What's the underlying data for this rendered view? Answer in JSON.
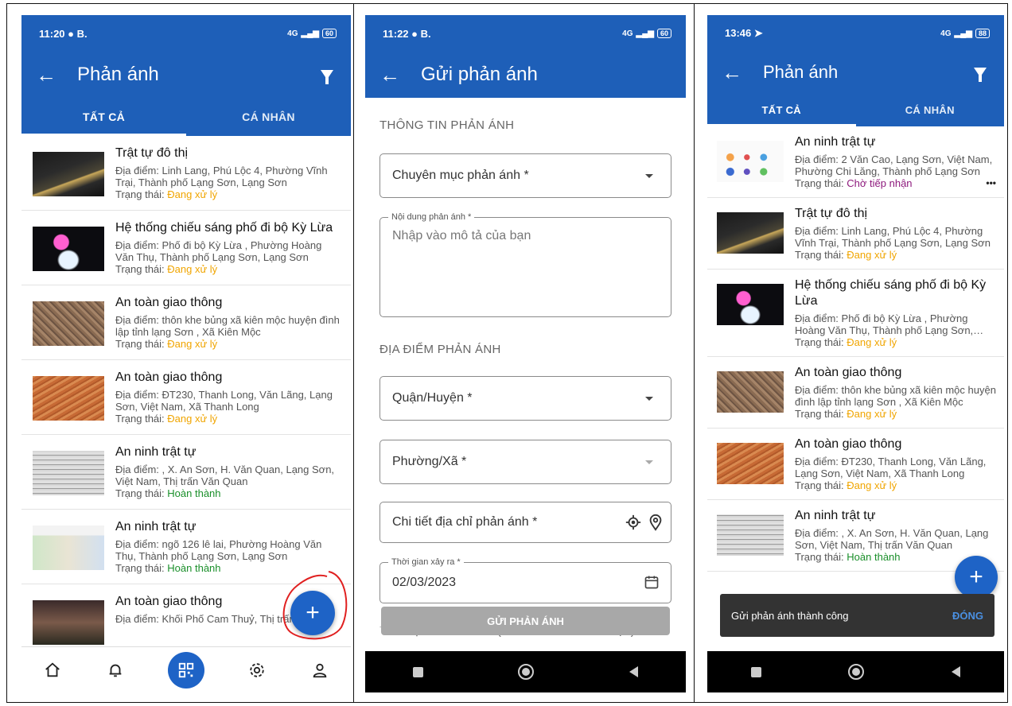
{
  "colors": {
    "primary": "#1e5fb8",
    "tab_bg": "#1e5fb8",
    "status_processing": "#f0a500",
    "status_done": "#1a8f2a",
    "status_waiting": "#8e1a7d"
  },
  "phone1": {
    "status": {
      "time": "11:20",
      "carrier": "B.",
      "network": "4G",
      "battery": "60"
    },
    "header": {
      "title": "Phản ánh"
    },
    "tabs": [
      "TẤT CẢ",
      "CÁ NHÂN"
    ],
    "items": [
      {
        "title": "Trật tự đô thị",
        "location": "Địa điểm: Linh Lang, Phú Lộc 4, Phường Vĩnh Trại, Thành phố Lạng Sơn, Lạng Sơn",
        "status_label": "Trạng thái: ",
        "status": "Đang xử lý"
      },
      {
        "title": "Hệ thống chiếu sáng phố đi bộ Kỳ Lừa",
        "location": "Địa điểm: Phố đi bộ Kỳ Lừa , Phường Hoàng Văn Thụ, Thành phố Lạng Sơn, Lạng Sơn",
        "status_label": "Trạng thái: ",
        "status": "Đang xử lý"
      },
      {
        "title": "An toàn giao thông",
        "location": "Địa điểm: thôn khe bủng xã kiên mộc huyện đình lập tỉnh lạng Sơn , Xã Kiên Mộc",
        "status_label": "Trạng thái: ",
        "status": "Đang xử lý"
      },
      {
        "title": "An toàn giao thông",
        "location": "Địa điểm: ĐT230, Thanh Long, Văn Lãng, Lạng Sơn, Việt Nam, Xã Thanh Long",
        "status_label": "Trạng thái: ",
        "status": "Đang xử lý"
      },
      {
        "title": "An ninh trật tự",
        "location": "Địa điểm: , X. An Sơn, H. Văn Quan, Lạng Sơn, Việt Nam, Thị trấn Văn Quan",
        "status_label": "Trạng thái: ",
        "status": "Hoàn thành"
      },
      {
        "title": "An ninh trật tự",
        "location": "Địa điểm: ngõ 126 lê lai, Phường Hoàng Văn Thụ, Thành phố Lạng Sơn, Lạng Sơn",
        "status_label": "Trạng thái: ",
        "status": "Hoàn thành"
      },
      {
        "title": "An toàn giao thông",
        "location": "Địa điểm: Khối Phố Cam Thuỷ, Thị trấn",
        "status_label": "",
        "status": ""
      }
    ],
    "fab": "+"
  },
  "phone2": {
    "status": {
      "time": "11:22",
      "carrier": "B.",
      "network": "4G",
      "battery": "60"
    },
    "header": {
      "title": "Gửi phản ánh"
    },
    "section_info": "THÔNG TIN PHẢN ÁNH",
    "category_field": "Chuyên mục phản ánh *",
    "content_label": "Nội dung phản ánh *",
    "content_placeholder": "Nhập vào mô tả của bạn",
    "section_location": "ĐỊA ĐIỂM PHẢN ÁNH",
    "district_field": "Quận/Huyện *",
    "ward_field": "Phường/Xã *",
    "address_field": "Chi tiết địa chỉ phản ánh *",
    "time_label": "Thời gian xảy ra *",
    "time_value": "02/03/2023",
    "section_attach": "TÀI LIỆU ĐÍNH KÈM (Hình ảnh/Video/Tài liệu) *",
    "submit": "GỬI PHẢN ÁNH"
  },
  "phone3": {
    "status": {
      "time": "13:46",
      "network": "4G",
      "battery": "88"
    },
    "header": {
      "title": "Phản ánh"
    },
    "tabs": [
      "TẤT CẢ",
      "CÁ NHÂN"
    ],
    "items": [
      {
        "title": "An ninh trật tự",
        "location": "Địa điểm: 2 Văn Cao, Lạng Sơn, Việt Nam, Phường Chi Lăng, Thành phố Lạng Sơn",
        "status_label": "Trạng thái: ",
        "status": "Chờ tiếp nhận"
      },
      {
        "title": "Trật tự đô thị",
        "location": "Địa điểm: Linh Lang, Phú Lộc 4, Phường Vĩnh Trại, Thành phố Lạng Sơn, Lạng Sơn",
        "status_label": "Trạng thái: ",
        "status": "Đang xử lý"
      },
      {
        "title": "Hệ thống chiếu sáng phố đi bộ Kỳ Lừa",
        "location": "Địa điểm: Phố đi bộ Kỳ Lừa , Phường Hoàng Văn Thụ, Thành phố Lạng Sơn, Lạng Sơn",
        "status_label": "Trạng thái: ",
        "status": "Đang xử lý"
      },
      {
        "title": "An toàn giao thông",
        "location": "Địa điểm: thôn khe bủng xã kiên mộc huyện đình lập tỉnh lạng Sơn , Xã Kiên Mộc",
        "status_label": "Trạng thái: ",
        "status": "Đang xử lý"
      },
      {
        "title": "An toàn giao thông",
        "location": "Địa điểm: ĐT230, Thanh Long, Văn Lãng, Lạng Sơn, Việt Nam, Xã Thanh Long",
        "status_label": "Trạng thái: ",
        "status": "Đang xử lý"
      },
      {
        "title": "An ninh trật tự",
        "location": "Địa điểm: , X. An Sơn, H. Văn Quan, Lạng Sơn, Việt Nam, Thị trấn Văn Quan",
        "status_label": "Trạng thái: ",
        "status": "Hoàn thành"
      }
    ],
    "more": "•••",
    "fab": "+",
    "snackbar": {
      "message": "Gửi phản ánh thành công",
      "action": "ĐÓNG"
    }
  }
}
